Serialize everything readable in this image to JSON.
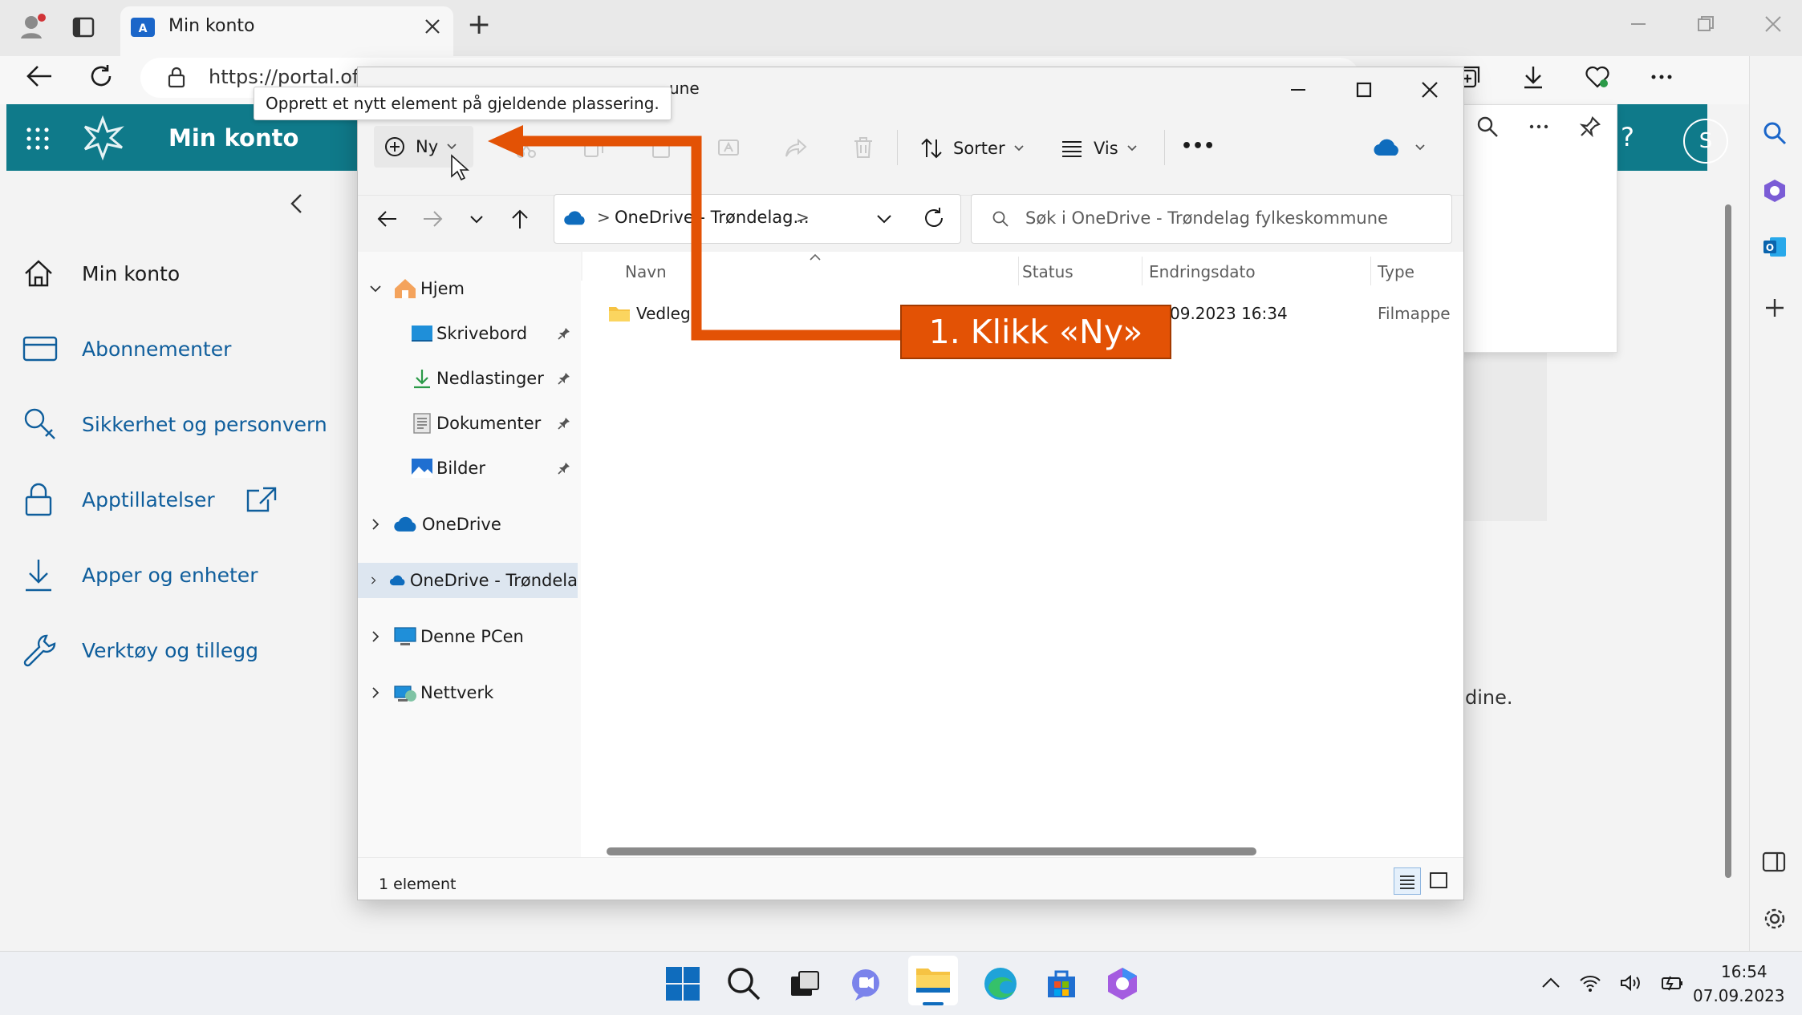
{
  "browser": {
    "tab_title": "Min konto",
    "url": "https://portal.offi",
    "new_tab_symbol": "+"
  },
  "m365": {
    "app_title": "Min konto",
    "help_symbol": "?",
    "avatar_initial": "S"
  },
  "left_nav": {
    "items": [
      {
        "label": "Min konto",
        "icon": "home-icon"
      },
      {
        "label": "Abonnementer",
        "icon": "card-icon"
      },
      {
        "label": "Sikkerhet og personvern",
        "icon": "key-icon"
      },
      {
        "label": "Apptillatelser",
        "icon": "lock-icon"
      },
      {
        "label": "Apper og enheter",
        "icon": "download-icon"
      },
      {
        "label": "Verktøy og tillegg",
        "icon": "wrench-icon"
      }
    ]
  },
  "background_page": {
    "partial_text": "dine."
  },
  "explorer": {
    "title_partial": "une",
    "tooltip": "Opprett et nytt element på gjeldende plassering.",
    "toolbar": {
      "new_label": "Ny",
      "sort_label": "Sorter",
      "view_label": "Vis",
      "more_label": "•••"
    },
    "path": {
      "segment": "OneDrive - Trøndelag...",
      "chevron": ">"
    },
    "search_placeholder": "Søk i OneDrive - Trøndelag fylkeskommune",
    "tree": [
      {
        "label": "Hjem",
        "level": 0,
        "expanded": true
      },
      {
        "label": "Skrivebord",
        "level": 1,
        "pinned": true
      },
      {
        "label": "Nedlastinger",
        "level": 1,
        "pinned": true
      },
      {
        "label": "Dokumenter",
        "level": 1,
        "pinned": true
      },
      {
        "label": "Bilder",
        "level": 1,
        "pinned": true
      },
      {
        "label": "OneDrive",
        "level": 0
      },
      {
        "label": "OneDrive - Trøndela",
        "level": 0,
        "selected": true
      },
      {
        "label": "Denne PCen",
        "level": 0
      },
      {
        "label": "Nettverk",
        "level": 0
      }
    ],
    "columns": [
      "Navn",
      "Status",
      "Endringsdato",
      "Type"
    ],
    "rows": [
      {
        "name": "Vedleg",
        "status": "",
        "date": "09.2023 16:34",
        "type": "Filmappe"
      }
    ],
    "status_text": "1 element"
  },
  "annotation": {
    "text": "1. Klikk «Ny»",
    "color": "#e35205"
  },
  "taskbar": {
    "time": "16:54",
    "date": "07.09.2023"
  }
}
